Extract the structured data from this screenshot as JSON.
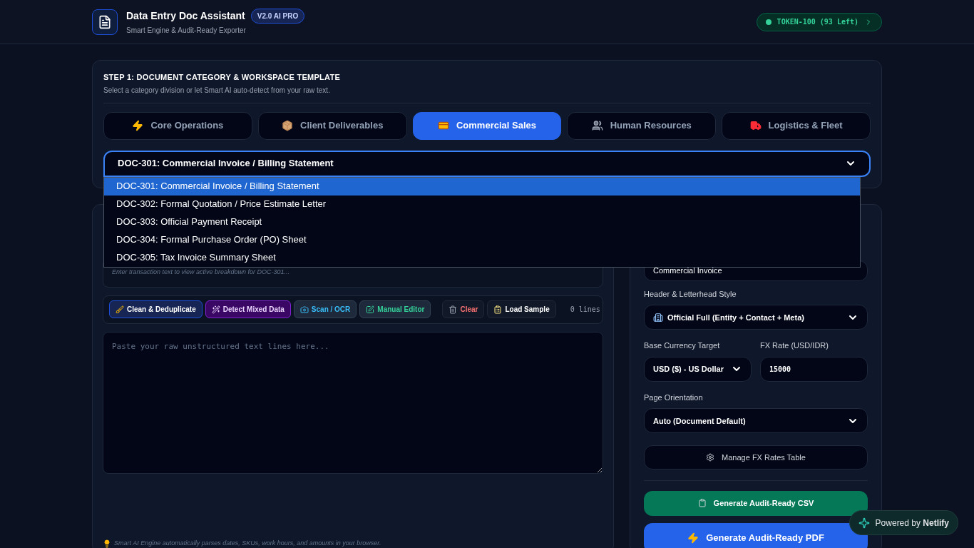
{
  "header": {
    "title": "Data Entry Doc Assistant",
    "badge": "V2.0 AI PRO",
    "subtitle": "Smart Engine & Audit-Ready Exporter",
    "token": "TOKEN-100 (93 Left)"
  },
  "step1": {
    "title": "STEP 1: DOCUMENT CATEGORY & WORKSPACE TEMPLATE",
    "subtitle": "Select a category division or let Smart AI auto-detect from your raw text.",
    "tabs": [
      {
        "label": "Core Operations",
        "selected": false
      },
      {
        "label": "Client Deliverables",
        "selected": false
      },
      {
        "label": "Commercial Sales",
        "selected": true
      },
      {
        "label": "Human Resources",
        "selected": false
      },
      {
        "label": "Logistics & Fleet",
        "selected": false
      }
    ],
    "template_select": {
      "value": "DOC-301: Commercial Invoice / Billing Statement",
      "expanded": true,
      "options": [
        {
          "label": "DOC-301: Commercial Invoice / Billing Statement",
          "selected": true
        },
        {
          "label": "DOC-302: Formal Quotation / Price Estimate Letter",
          "selected": false
        },
        {
          "label": "DOC-303: Official Payment Receipt",
          "selected": false
        },
        {
          "label": "DOC-304: Formal Purchase Order (PO) Sheet",
          "selected": false
        },
        {
          "label": "DOC-305: Tax Invoice Summary Sheet",
          "selected": false
        }
      ]
    }
  },
  "workspace": {
    "breakdown_hint": "Enter transaction text to view active breakdown for DOC-301...",
    "tools": [
      {
        "label": "Clean & Deduplicate",
        "kind": "clean"
      },
      {
        "label": "Detect Mixed Data",
        "kind": "detect"
      },
      {
        "label": "Scan / OCR",
        "kind": "scan"
      },
      {
        "label": "Manual Editor",
        "kind": "edit"
      }
    ],
    "actions": [
      {
        "label": "Clear",
        "kind": "clear"
      },
      {
        "label": "Load Sample",
        "kind": "sample"
      }
    ],
    "line_count": "0 lines",
    "editor_placeholder": "Paste your raw unstructured text lines here...",
    "note": "Smart AI Engine automatically parses dates, SKUs, work hours, and amounts in your browser."
  },
  "settings": {
    "document_title": "Commercial Invoice",
    "header_style": {
      "label": "Header & Letterhead Style",
      "value": "Official Full (Entity + Contact + Meta)"
    },
    "currency": {
      "label": "Base Currency Target",
      "value": "USD ($) - US Dollar"
    },
    "fx_rate": {
      "label": "FX Rate (USD/IDR)",
      "value": "15000"
    },
    "orientation": {
      "label": "Page Orientation",
      "value": "Auto (Document Default)"
    },
    "manage_button": "Manage FX Rates Table",
    "csv_button": "Generate Audit-Ready CSV",
    "pdf_button": "Generate Audit-Ready PDF"
  },
  "netlify_badge": "Powered by **Netlify**"
}
